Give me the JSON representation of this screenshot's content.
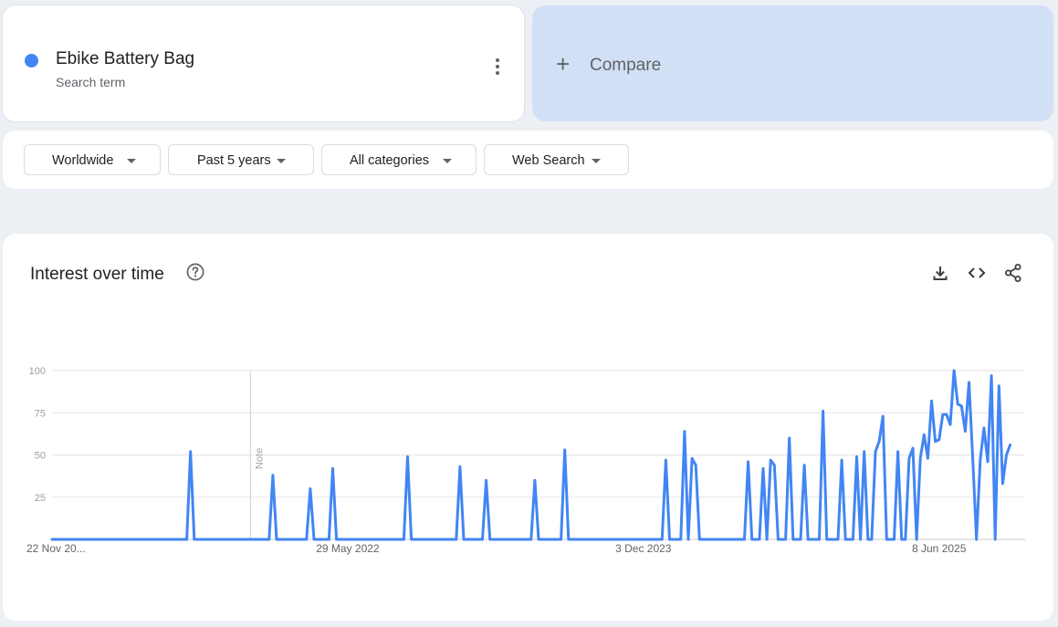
{
  "search_term": {
    "name": "Ebike Battery Bag",
    "subtitle": "Search term",
    "color": "#4285f4"
  },
  "compare": {
    "label": "Compare",
    "icon": "plus-icon"
  },
  "filters": [
    {
      "label": "Worldwide"
    },
    {
      "label": "Past 5 years"
    },
    {
      "label": "All categories"
    },
    {
      "label": "Web Search"
    }
  ],
  "chart_card": {
    "title": "Interest over time",
    "icons": [
      "help-icon",
      "download-icon",
      "embed-icon",
      "share-icon"
    ]
  },
  "chart_data": {
    "type": "line",
    "title": "Interest over time",
    "xlabel": "",
    "ylabel": "",
    "ylim": [
      0,
      100
    ],
    "y_ticks": [
      100,
      75,
      50,
      25
    ],
    "x_range": [
      "2020-11-22",
      "2025-11-16"
    ],
    "x_tick_labels": [
      {
        "date": "2020-11-22",
        "label": "22 Nov 20..."
      },
      {
        "date": "2022-05-29",
        "label": "29 May 2022"
      },
      {
        "date": "2023-12-03",
        "label": "3 Dec 2023"
      },
      {
        "date": "2025-06-08",
        "label": "8 Jun 2025"
      }
    ],
    "grid": true,
    "annotations": [
      {
        "date": "2021-11-28",
        "label": "Note"
      }
    ],
    "series": [
      {
        "color": "#4285f4",
        "points": [
          [
            "2020-11-22",
            0
          ],
          [
            "2021-08-01",
            0
          ],
          [
            "2021-08-08",
            52
          ],
          [
            "2021-08-15",
            0
          ],
          [
            "2022-01-02",
            0
          ],
          [
            "2022-01-09",
            38
          ],
          [
            "2022-01-16",
            0
          ],
          [
            "2022-03-13",
            0
          ],
          [
            "2022-03-20",
            30
          ],
          [
            "2022-03-27",
            0
          ],
          [
            "2022-04-24",
            0
          ],
          [
            "2022-05-01",
            42
          ],
          [
            "2022-05-08",
            0
          ],
          [
            "2022-09-11",
            0
          ],
          [
            "2022-09-18",
            49
          ],
          [
            "2022-09-25",
            0
          ],
          [
            "2022-12-18",
            0
          ],
          [
            "2022-12-25",
            43
          ],
          [
            "2023-01-01",
            0
          ],
          [
            "2023-02-05",
            0
          ],
          [
            "2023-02-12",
            35
          ],
          [
            "2023-02-19",
            0
          ],
          [
            "2023-05-07",
            0
          ],
          [
            "2023-05-14",
            35
          ],
          [
            "2023-05-21",
            0
          ],
          [
            "2023-07-02",
            0
          ],
          [
            "2023-07-09",
            53
          ],
          [
            "2023-07-16",
            0
          ],
          [
            "2024-01-07",
            0
          ],
          [
            "2024-01-14",
            47
          ],
          [
            "2024-01-21",
            0
          ],
          [
            "2024-02-11",
            0
          ],
          [
            "2024-02-18",
            64
          ],
          [
            "2024-02-25",
            0
          ],
          [
            "2024-03-03",
            48
          ],
          [
            "2024-03-10",
            44
          ],
          [
            "2024-03-17",
            0
          ],
          [
            "2024-06-09",
            0
          ],
          [
            "2024-06-16",
            46
          ],
          [
            "2024-06-23",
            0
          ],
          [
            "2024-07-07",
            0
          ],
          [
            "2024-07-14",
            42
          ],
          [
            "2024-07-21",
            0
          ],
          [
            "2024-07-28",
            47
          ],
          [
            "2024-08-04",
            44
          ],
          [
            "2024-08-11",
            0
          ],
          [
            "2024-08-25",
            0
          ],
          [
            "2024-09-01",
            60
          ],
          [
            "2024-09-08",
            0
          ],
          [
            "2024-09-22",
            0
          ],
          [
            "2024-09-29",
            44
          ],
          [
            "2024-10-06",
            0
          ],
          [
            "2024-10-27",
            0
          ],
          [
            "2024-11-03",
            76
          ],
          [
            "2024-11-10",
            0
          ],
          [
            "2024-12-01",
            0
          ],
          [
            "2024-12-08",
            47
          ],
          [
            "2024-12-15",
            0
          ],
          [
            "2024-12-29",
            0
          ],
          [
            "2025-01-05",
            49
          ],
          [
            "2025-01-12",
            0
          ],
          [
            "2025-01-19",
            52
          ],
          [
            "2025-01-26",
            0
          ],
          [
            "2025-02-02",
            0
          ],
          [
            "2025-02-09",
            52
          ],
          [
            "2025-02-16",
            58
          ],
          [
            "2025-02-23",
            73
          ],
          [
            "2025-03-02",
            0
          ],
          [
            "2025-03-16",
            0
          ],
          [
            "2025-03-23",
            52
          ],
          [
            "2025-03-30",
            0
          ],
          [
            "2025-04-06",
            0
          ],
          [
            "2025-04-13",
            48
          ],
          [
            "2025-04-20",
            54
          ],
          [
            "2025-04-27",
            0
          ],
          [
            "2025-05-04",
            48
          ],
          [
            "2025-05-11",
            62
          ],
          [
            "2025-05-18",
            48
          ],
          [
            "2025-05-25",
            82
          ],
          [
            "2025-06-01",
            58
          ],
          [
            "2025-06-08",
            59
          ],
          [
            "2025-06-15",
            74
          ],
          [
            "2025-06-22",
            74
          ],
          [
            "2025-06-29",
            68
          ],
          [
            "2025-07-06",
            100
          ],
          [
            "2025-07-13",
            80
          ],
          [
            "2025-07-20",
            79
          ],
          [
            "2025-07-27",
            64
          ],
          [
            "2025-08-03",
            93
          ],
          [
            "2025-08-10",
            48
          ],
          [
            "2025-08-17",
            0
          ],
          [
            "2025-08-24",
            47
          ],
          [
            "2025-08-31",
            66
          ],
          [
            "2025-09-07",
            46
          ],
          [
            "2025-09-14",
            97
          ],
          [
            "2025-09-21",
            0
          ],
          [
            "2025-09-28",
            91
          ],
          [
            "2025-10-05",
            33
          ],
          [
            "2025-10-12",
            50
          ],
          [
            "2025-10-19",
            56
          ]
        ]
      }
    ]
  }
}
